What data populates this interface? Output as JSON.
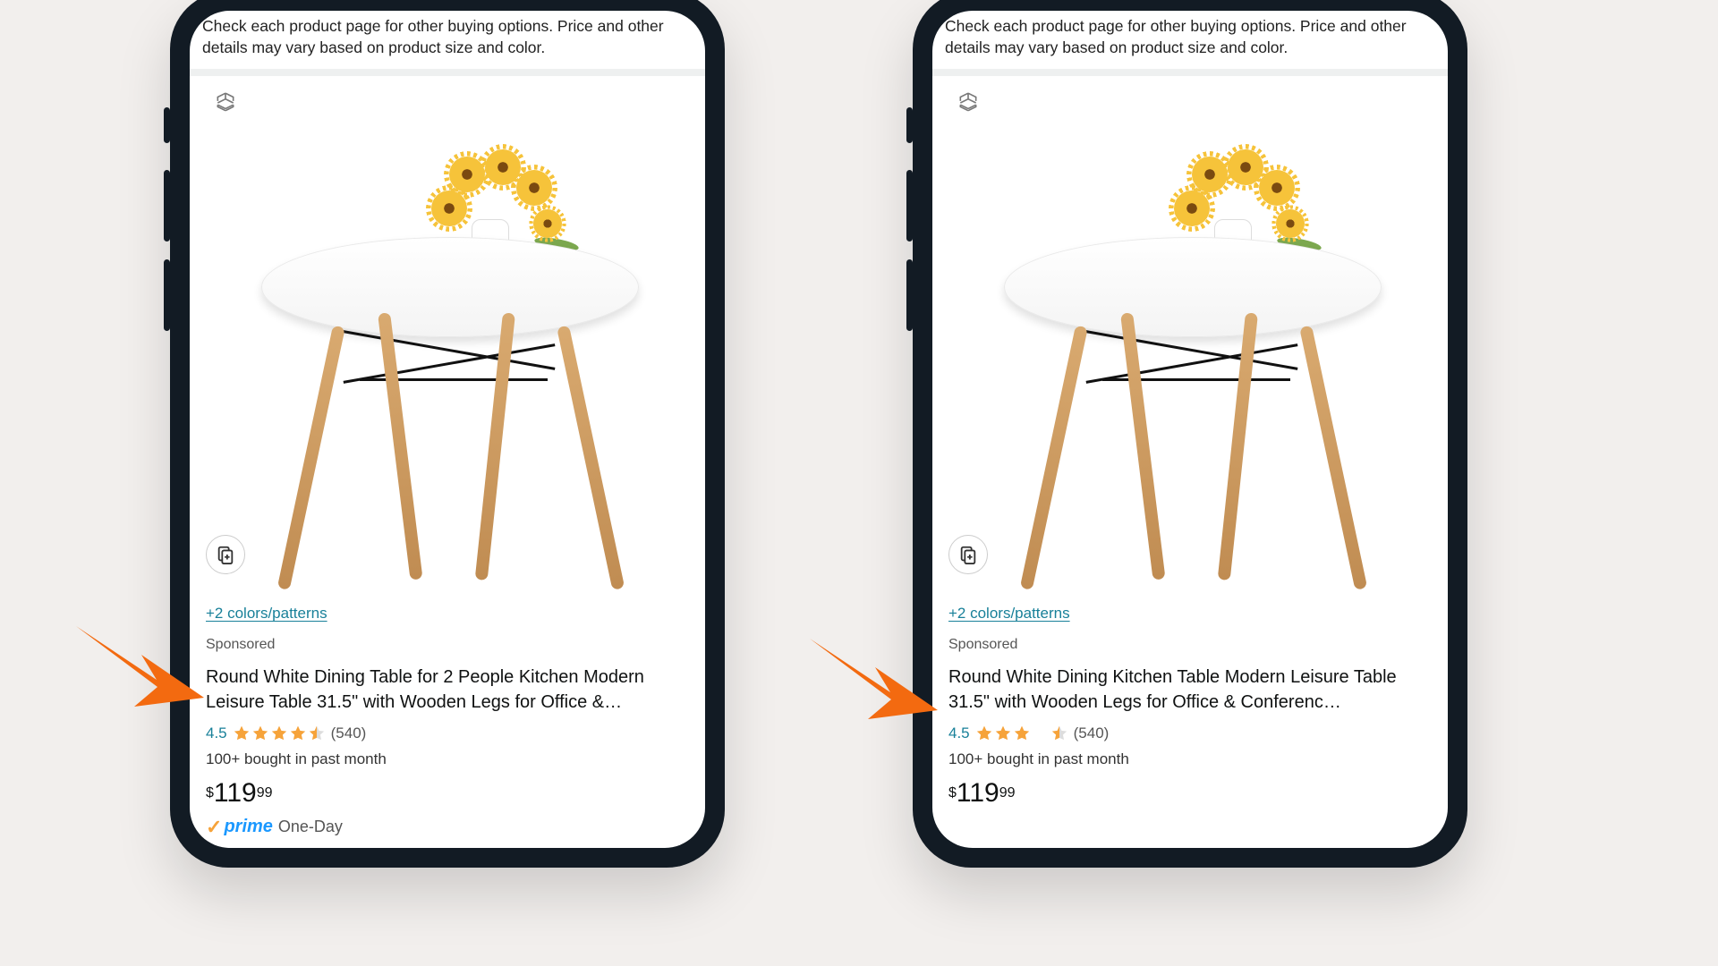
{
  "notice": "Check each product page for other buying options. Price and other details may vary based on product size and color.",
  "colors_link": "+2 colors/patterns",
  "sponsored": "Sponsored",
  "rating": "4.5",
  "review_count": "(540)",
  "bought": "100+ bought in past month",
  "price": {
    "currency": "$",
    "whole": "119",
    "cents": "99"
  },
  "prime": "prime",
  "delivery": "One-Day",
  "left": {
    "title": "Round White Dining Table for 2 People Kitchen Modern Leisure Table 31.5\" with Wooden Legs for Office &…"
  },
  "right": {
    "title": "Round White Dining Kitchen Table Modern Leisure Table 31.5\" with Wooden Legs for Office & Conferenc…"
  }
}
